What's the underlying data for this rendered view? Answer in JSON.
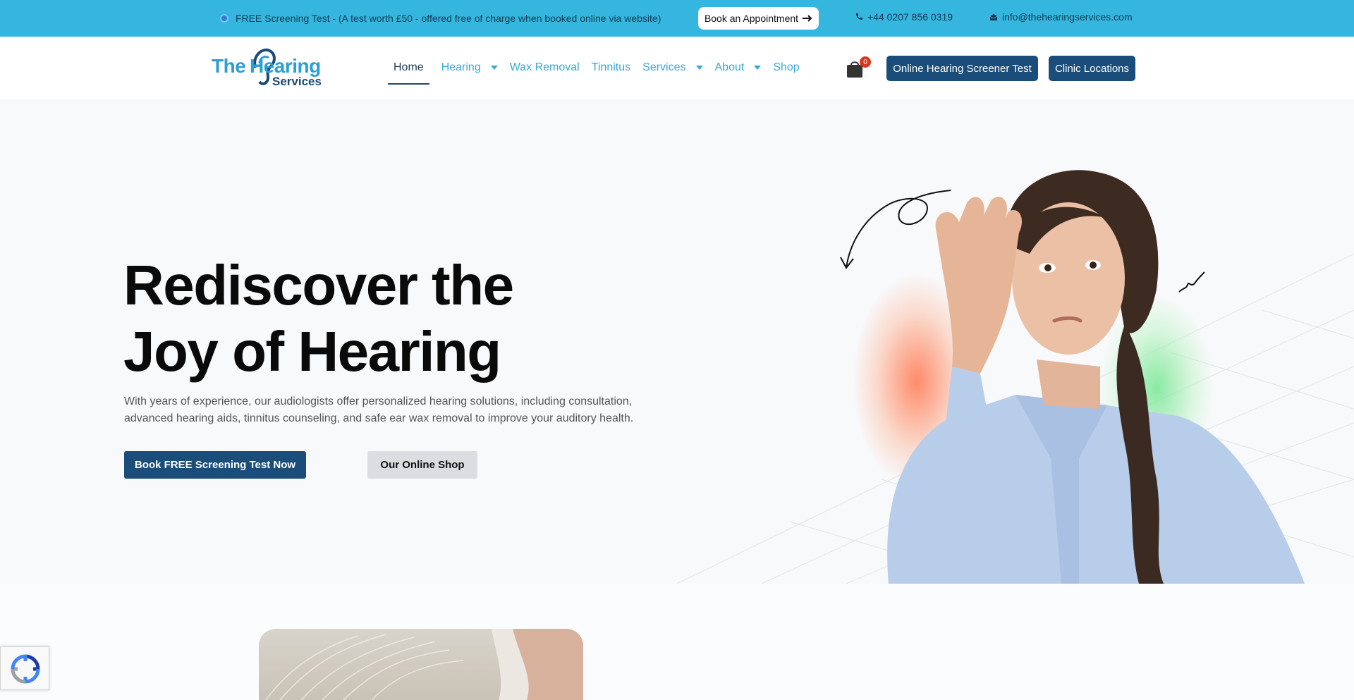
{
  "topbar": {
    "promo_text": "FREE Screening Test - (A test worth £50 - offered free of charge when booked online via website)",
    "book_label": "Book an Appointment",
    "phone": "+44 0207 856 0319",
    "email": "info@thehearingservices.com"
  },
  "logo": {
    "the": "The",
    "hearing": "Hearing",
    "services": "Services"
  },
  "nav": {
    "items": [
      {
        "label": "Home",
        "active": true,
        "dropdown": false
      },
      {
        "label": "Hearing",
        "active": false,
        "dropdown": true
      },
      {
        "label": "Wax Removal",
        "active": false,
        "dropdown": false
      },
      {
        "label": "Tinnitus",
        "active": false,
        "dropdown": false
      },
      {
        "label": "Services",
        "active": false,
        "dropdown": true
      },
      {
        "label": "About",
        "active": false,
        "dropdown": true
      },
      {
        "label": "Shop",
        "active": false,
        "dropdown": false
      }
    ]
  },
  "cart": {
    "count": "0"
  },
  "header_buttons": {
    "screener": "Online Hearing Screener Test",
    "clinics": "Clinic Locations"
  },
  "hero": {
    "title_line1": "Rediscover the",
    "title_line2": "Joy of Hearing",
    "description": "With years of experience, our audiologists offer personalized hearing solutions, including consultation, advanced hearing aids, tinnitus counseling, and safe ear wax removal to improve your auditory health.",
    "primary_button": "Book FREE Screening Test Now",
    "secondary_button": "Our Online Shop"
  },
  "colors": {
    "topbar": "#35b6df",
    "primary": "#1a4d7a",
    "nav_link": "#35a9d9",
    "badge": "#d9361f"
  }
}
